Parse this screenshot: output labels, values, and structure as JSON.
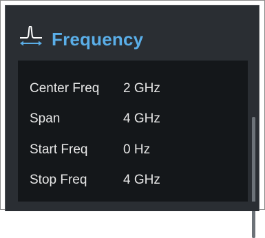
{
  "panel": {
    "title": "Frequency",
    "icon": "frequency-peak-icon",
    "accent_color": "#5aaee8",
    "background_color": "#2a2e33",
    "list_background_color": "#14171a"
  },
  "parameters": [
    {
      "label": "Center Freq",
      "value": "2 GHz"
    },
    {
      "label": "Span",
      "value": "4 GHz"
    },
    {
      "label": "Start Freq",
      "value": "0 Hz"
    },
    {
      "label": "Stop Freq",
      "value": "4 GHz"
    }
  ]
}
